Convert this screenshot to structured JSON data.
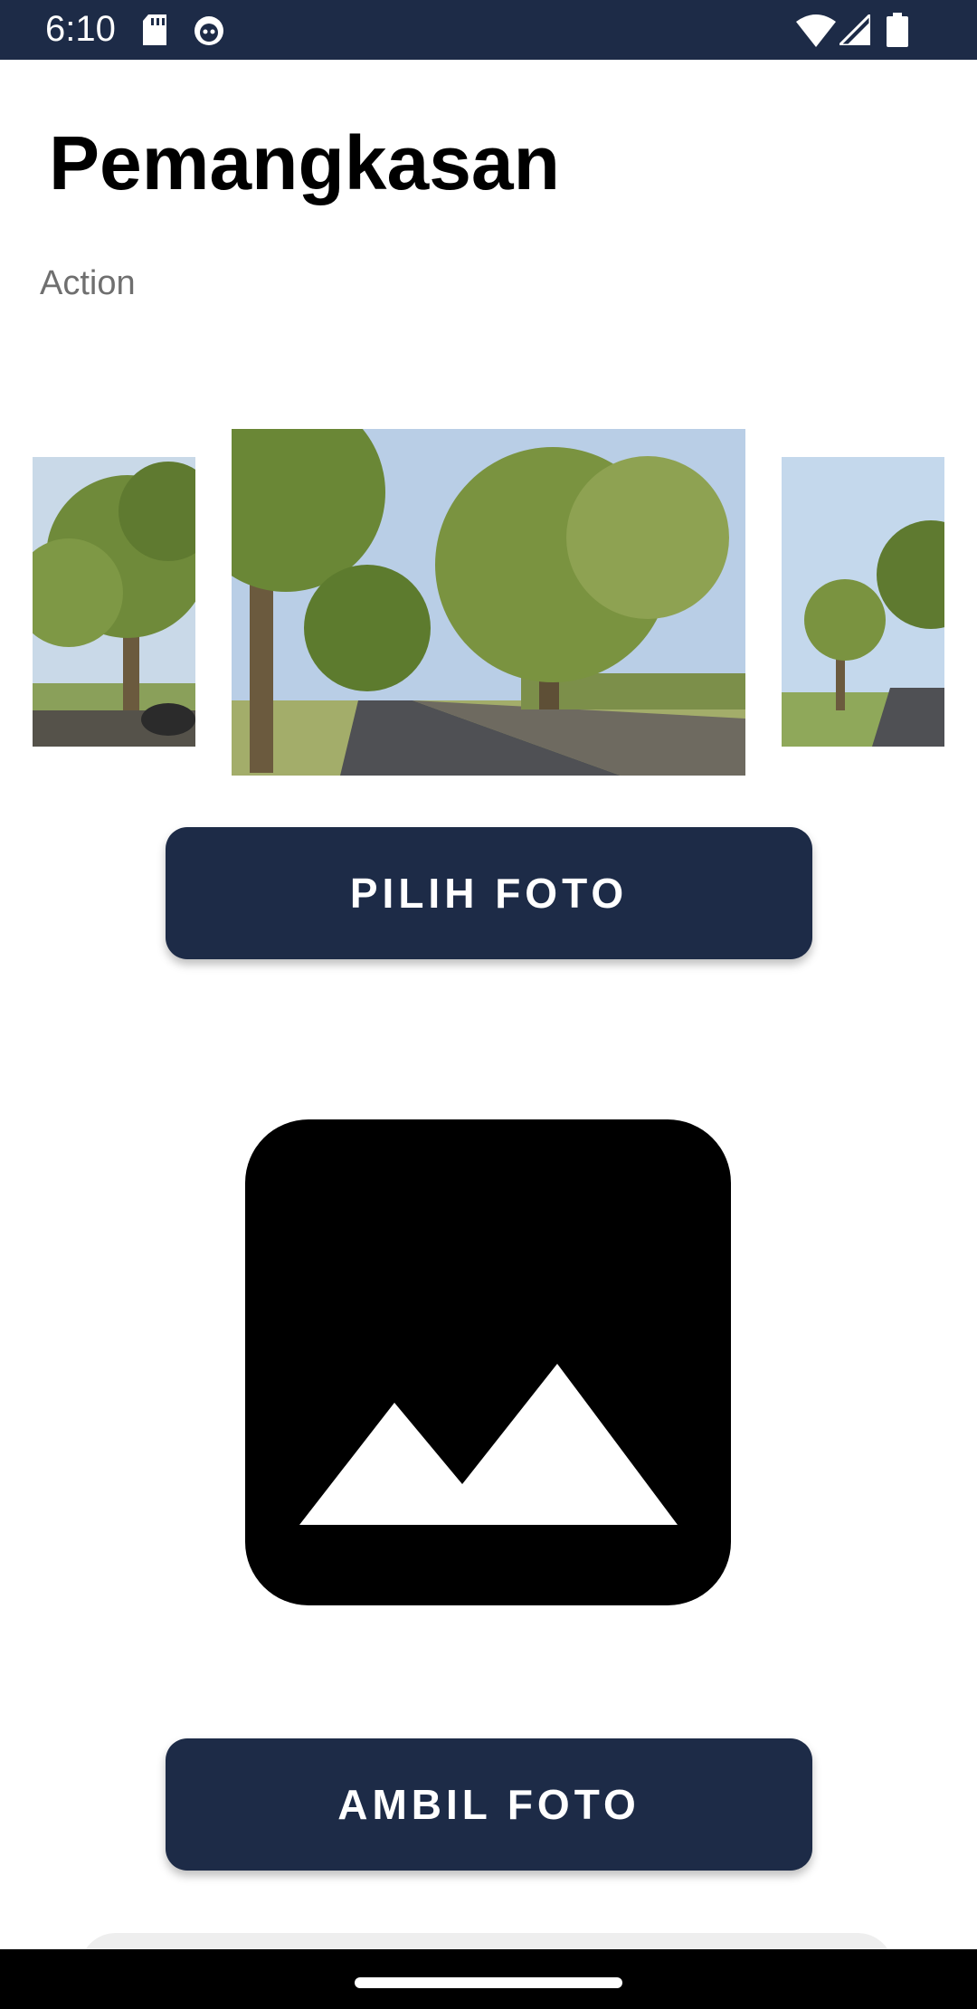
{
  "status_bar": {
    "time": "6:10",
    "icons": [
      "sd-card-icon",
      "android-face-icon",
      "wifi-icon",
      "signal-icon",
      "battery-icon"
    ]
  },
  "header": {
    "title": "Pemangkasan",
    "subtitle": "Action"
  },
  "carousel": {
    "images": [
      "tree-photo-left",
      "tree-road-photo-center",
      "tree-road-photo-right"
    ]
  },
  "buttons": {
    "pick_photo": "PILIH FOTO",
    "take_photo": "AMBIL FOTO"
  },
  "placeholder": {
    "icon": "image-placeholder-icon"
  },
  "colors": {
    "primary": "#1d2b47",
    "background": "#ffffff",
    "subtitle": "#6f6f6f"
  }
}
